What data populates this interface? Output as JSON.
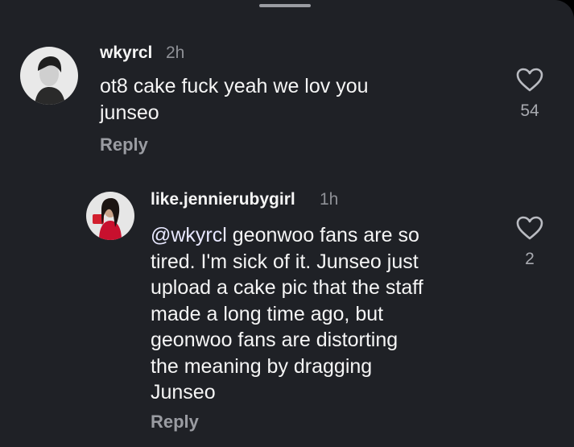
{
  "comments": [
    {
      "username": "wkyrcl",
      "time": "2h",
      "text": "ot8 cake fuck yeah we lov you\njunseo",
      "reply_label": "Reply",
      "likes": "54",
      "like_icon": "heart-outline-icon"
    }
  ],
  "replies": [
    {
      "username": "like.jennierubygirl",
      "time": "1h",
      "mention": "@wkyrcl",
      "text": " geonwoo fans are so\ntired. I'm sick of it. Junseo just\nupload a cake pic that the staff\nmade a long time ago, but\ngeonwoo fans are distorting\nthe meaning by dragging\nJunseo",
      "reply_label": "Reply",
      "likes": "2",
      "like_icon": "heart-outline-icon"
    }
  ],
  "colors": {
    "background": "#1f2126",
    "primary_text": "#f5f5f5",
    "secondary_text": "#9a9ca2"
  }
}
